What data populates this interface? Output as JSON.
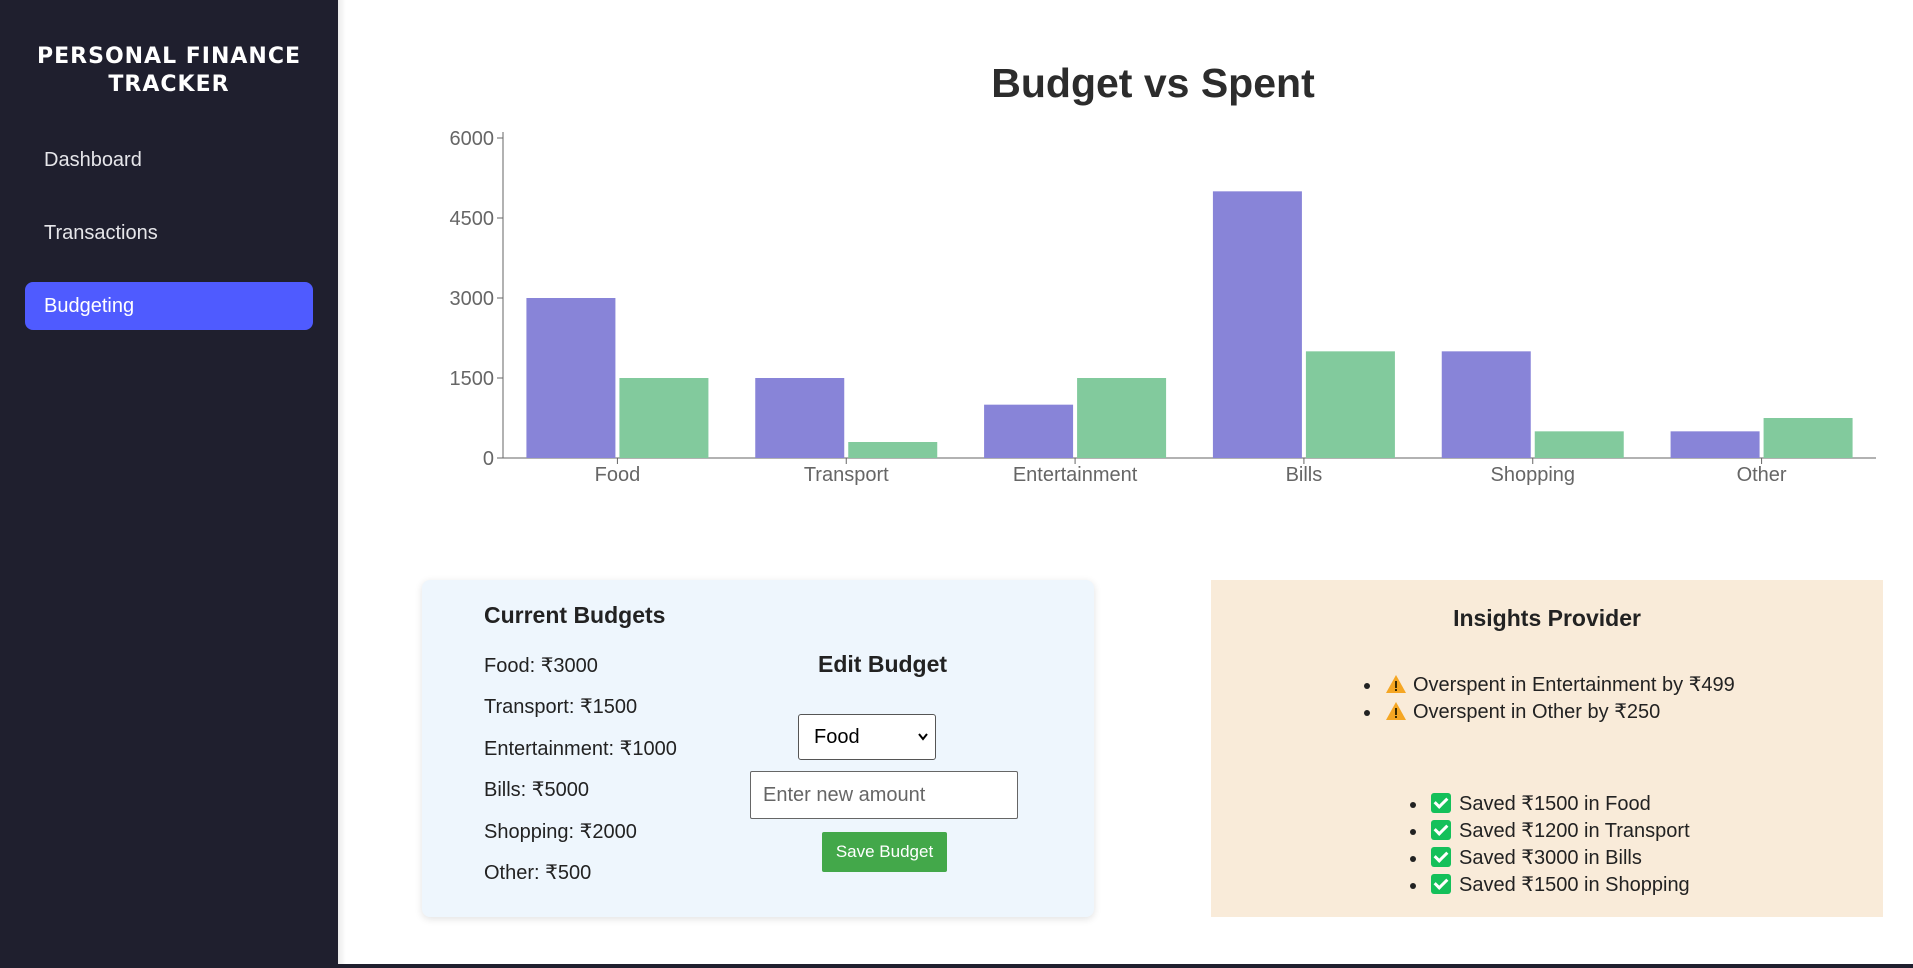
{
  "sidebar": {
    "brand_line1": "PERSONAL FINANCE",
    "brand_line2": "TRACKER",
    "items": [
      {
        "label": "Dashboard",
        "active": false
      },
      {
        "label": "Transactions",
        "active": false
      },
      {
        "label": "Budgeting",
        "active": true
      }
    ]
  },
  "chart_data": {
    "type": "bar",
    "title": "Budget vs Spent",
    "categories": [
      "Food",
      "Transport",
      "Entertainment",
      "Bills",
      "Shopping",
      "Other"
    ],
    "series": [
      {
        "values": [
          3000,
          1500,
          1000,
          5000,
          2000,
          500
        ],
        "color": "#8884d8"
      },
      {
        "values": [
          1500,
          300,
          1500,
          2000,
          500,
          750
        ],
        "color": "#82ca9d"
      }
    ],
    "y_ticks": [
      "0",
      "1500",
      "3000",
      "4500",
      "6000"
    ],
    "ylim": [
      0,
      6000
    ],
    "grid": false
  },
  "budget_card": {
    "title": "Current Budgets",
    "items": [
      "Food: ₹3000",
      "Transport: ₹1500",
      "Entertainment: ₹1000",
      "Bills: ₹5000",
      "Shopping: ₹2000",
      "Other: ₹500"
    ],
    "edit_title": "Edit Budget",
    "selected_category": "Food",
    "amount_placeholder": "Enter new amount",
    "amount_value": "",
    "save_label": "Save Budget"
  },
  "insights": {
    "title": "Insights Provider",
    "warnings": [
      "Overspent in Entertainment by ₹499",
      "Overspent in Other by ₹250"
    ],
    "savings": [
      "Saved ₹1500 in Food",
      "Saved ₹1200 in Transport",
      "Saved ₹3000 in Bills",
      "Saved ₹1500 in Shopping"
    ],
    "colors": {
      "warning": "#f5a623",
      "check": "#14c05a"
    }
  }
}
